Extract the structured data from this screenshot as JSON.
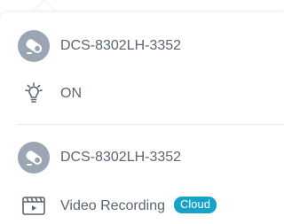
{
  "devices": [
    {
      "name": "DCS-8302LH-3352",
      "icon": "camera-icon"
    },
    {
      "name": "DCS-8302LH-3352",
      "icon": "camera-icon"
    }
  ],
  "light_action": {
    "label": "ON",
    "icon": "light-bulb-icon"
  },
  "recording_action": {
    "label": "Video Recording",
    "badge": "Cloud",
    "icon": "video-clapper-icon"
  },
  "colors": {
    "text": "#5b6672",
    "icon_bg": "#9aa6b3",
    "badge_bg": "#17a3c9",
    "divider": "#e3e6ea"
  }
}
